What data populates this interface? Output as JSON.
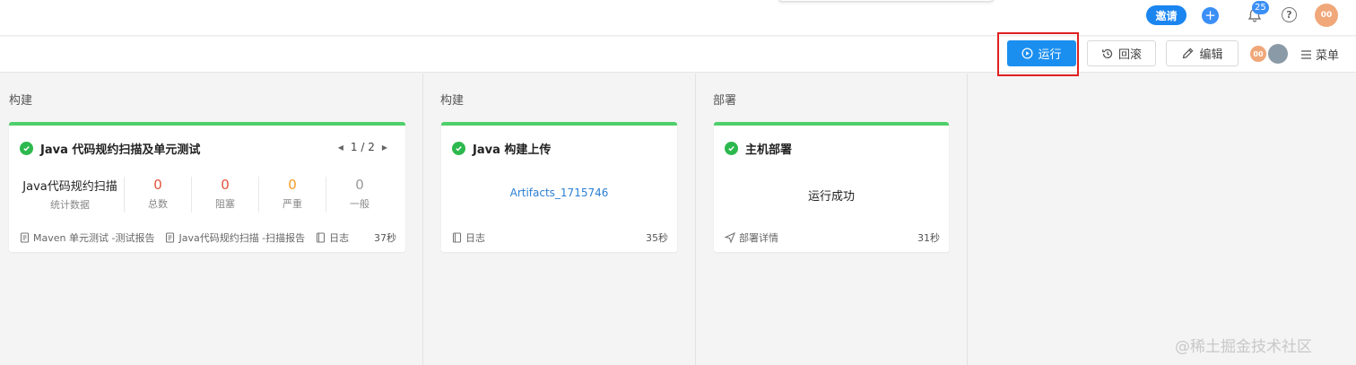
{
  "header": {
    "invite_label": "邀请",
    "plus_label": "+",
    "notification_count": "25",
    "help_label": "?",
    "user_avatar_text": "00"
  },
  "toolbar": {
    "run_label": "运行",
    "rollback_label": "回滚",
    "edit_label": "编辑",
    "menu_label": "菜单",
    "member_avatar_text": "00"
  },
  "stages": [
    {
      "title": "构建",
      "card": {
        "name": "Java 代码规约扫描及单元测试",
        "pager": "1 / 2",
        "stats_title": "Java代码规约扫描",
        "stats_subtitle": "统计数据",
        "stats": [
          {
            "value": "0",
            "label": "总数",
            "color": "#e0533b"
          },
          {
            "value": "0",
            "label": "阻塞",
            "color": "#e0533b"
          },
          {
            "value": "0",
            "label": "严重",
            "color": "#f59a23"
          },
          {
            "value": "0",
            "label": "一般",
            "color": "#999999"
          }
        ],
        "footer": [
          "Maven 单元测试 -测试报告",
          "Java代码规约扫描 -扫描报告",
          "日志"
        ],
        "duration": "37秒"
      }
    },
    {
      "title": "构建",
      "card": {
        "name": "Java 构建上传",
        "artifact": "Artifacts_1715746",
        "footer": [
          "日志"
        ],
        "duration": "35秒"
      }
    },
    {
      "title": "部署",
      "card": {
        "name": "主机部署",
        "status": "运行成功",
        "footer": [
          "部署详情"
        ],
        "duration": "31秒"
      }
    }
  ],
  "watermark": "@稀土掘金技术社区",
  "colors": {
    "primary": "#1b8ff0",
    "success": "#2db84d",
    "card_top_border": "#4fcf6a",
    "highlight_border": "#e02020"
  }
}
